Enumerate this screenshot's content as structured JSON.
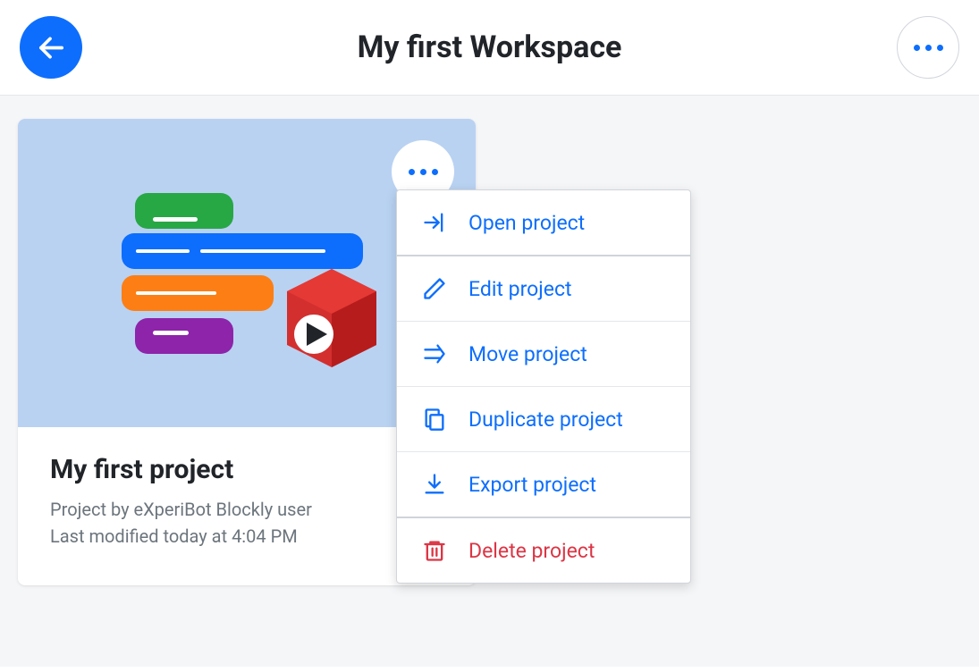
{
  "header": {
    "title": "My first Workspace"
  },
  "project": {
    "name": "My first project",
    "author_line": "Project by eXperiBot Blockly user",
    "modified_line": "Last modified today at 4:04 PM"
  },
  "menu": {
    "open": "Open project",
    "edit": "Edit project",
    "move": "Move project",
    "duplicate": "Duplicate project",
    "export": "Export project",
    "delete": "Delete project"
  },
  "colors": {
    "primary": "#0d6efd",
    "danger": "#dc3545"
  }
}
